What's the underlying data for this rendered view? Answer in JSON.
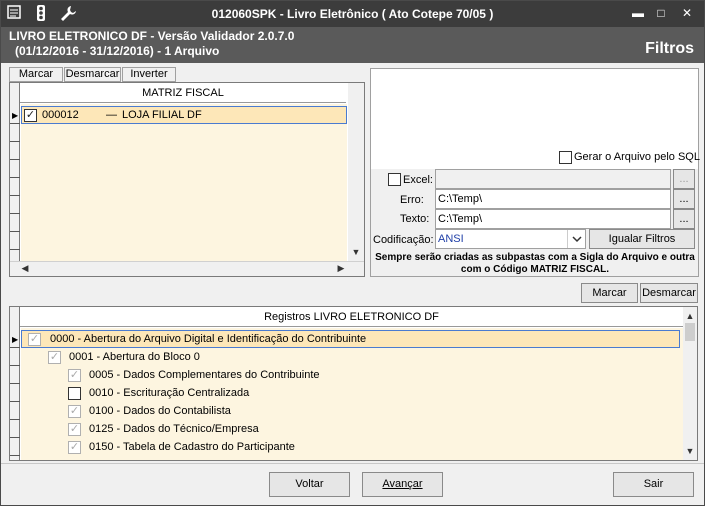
{
  "window": {
    "title": "012060SPK - Livro Eletrônico ( Ato Cotepe 70/05 )",
    "min_glyph": "▬",
    "max_glyph": "□",
    "close_glyph": "✕"
  },
  "header": {
    "line1": "LIVRO ELETRONICO DF - Versão Validador 2.0.7.0",
    "line2": "(01/12/2016 - 31/12/2016) - 1 Arquivo",
    "section": "Filtros"
  },
  "top_tabs": {
    "marcar": "Marcar",
    "desmarcar": "Desmarcar",
    "inverter": "Inverter"
  },
  "matriz_grid": {
    "header": "MATRIZ FISCAL",
    "rows": [
      {
        "code": "000012",
        "sep": "—",
        "name": "LOJA FILIAL DF",
        "checked": "✓"
      }
    ]
  },
  "filters": {
    "gerar_sql_label": "Gerar o Arquivo pelo SQL",
    "excel_label": "Excel:",
    "excel_value": "",
    "erro_label": "Erro:",
    "erro_value": "C:\\Temp\\",
    "texto_label": "Texto:",
    "texto_value": "C:\\Temp\\",
    "codificacao_label": "Codificação:",
    "codificacao_value": "ANSI",
    "browse_label": "...",
    "igualar_label": "Igualar Filtros",
    "note": "Sempre serão criadas as subpastas com a Sigla do Arquivo e outra com o Código MATRIZ FISCAL."
  },
  "registros_buttons": {
    "marcar": "Marcar",
    "desmarcar": "Desmarcar"
  },
  "registros_grid": {
    "header": "Registros LIVRO ELETRONICO DF",
    "rows": [
      {
        "text": "0000 - Abertura do Arquivo Digital e Identificação do Contribuinte",
        "check": "✓"
      },
      {
        "text": "0001 - Abertura do Bloco 0",
        "check": "✓"
      },
      {
        "text": "0005 - Dados Complementares do Contribuinte",
        "check": "✓"
      },
      {
        "text": "0010 - Escrituração Centralizada",
        "check": ""
      },
      {
        "text": "0100 - Dados do Contabilista",
        "check": "✓"
      },
      {
        "text": "0125 - Dados do Técnico/Empresa",
        "check": "✓"
      },
      {
        "text": "0150 - Tabela de Cadastro do Participante",
        "check": "✓"
      }
    ]
  },
  "footer": {
    "voltar": "Voltar",
    "avancar": "Avançar",
    "sair": "Sair"
  },
  "colors": {
    "titlebar": "#3c3c3c",
    "header": "#5a5a5a",
    "row_highlight": "#fde7b8",
    "grid_background": "#fdf5e0"
  }
}
